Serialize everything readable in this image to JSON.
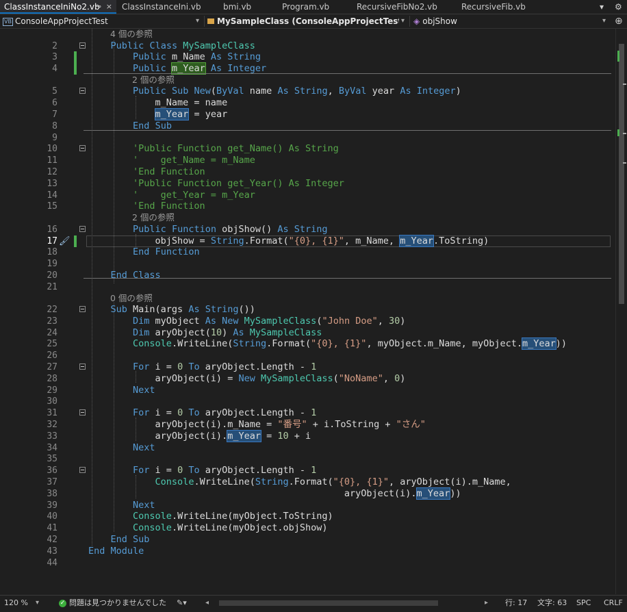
{
  "tabs": [
    {
      "label": "ClassInstanceIniNo2.vb",
      "active": true
    },
    {
      "label": "ClassInstanceIni.vb"
    },
    {
      "label": "bmi.vb"
    },
    {
      "label": "Program.vb"
    },
    {
      "label": "RecursiveFibNo2.vb"
    },
    {
      "label": "RecursiveFib.vb"
    }
  ],
  "tab_controls": {
    "overflow": "▾",
    "settings": "⚙"
  },
  "tab_close": "×",
  "tab_pin": "⊸",
  "navbar": {
    "project": "ConsoleAppProjectTest",
    "class": "MySampleClass (ConsoleAppProjectTest.Program",
    "member": "objShow",
    "vb_badge": "VB"
  },
  "code_lines": [
    {
      "n": "",
      "hint": "4 個の参照"
    },
    {
      "n": "2",
      "code": "    Public Class MySampleClass"
    },
    {
      "n": "3",
      "code": "        Public m_Name As String"
    },
    {
      "n": "4",
      "code": "        Public m_Year As Integer"
    },
    {
      "n": "",
      "hint": "2 個の参照"
    },
    {
      "n": "5",
      "code": "        Public Sub New(ByVal name As String, ByVal year As Integer)"
    },
    {
      "n": "6",
      "code": "            m_Name = name"
    },
    {
      "n": "7",
      "code": "            m_Year = year"
    },
    {
      "n": "8",
      "code": "        End Sub"
    },
    {
      "n": "9",
      "code": ""
    },
    {
      "n": "10",
      "code": "        'Public Function get_Name() As String"
    },
    {
      "n": "11",
      "code": "        '    get_Name = m_Name"
    },
    {
      "n": "12",
      "code": "        'End Function"
    },
    {
      "n": "13",
      "code": "        'Public Function get_Year() As Integer"
    },
    {
      "n": "14",
      "code": "        '    get_Year = m_Year"
    },
    {
      "n": "15",
      "code": "        'End Function"
    },
    {
      "n": "",
      "hint": "2 個の参照"
    },
    {
      "n": "16",
      "code": "        Public Function objShow() As String"
    },
    {
      "n": "17",
      "code": "            objShow = String.Format(\"{0}, {1}\", m_Name, m_Year.ToString)"
    },
    {
      "n": "18",
      "code": "        End Function"
    },
    {
      "n": "19",
      "code": ""
    },
    {
      "n": "20",
      "code": "    End Class"
    },
    {
      "n": "21",
      "code": ""
    },
    {
      "n": "",
      "hint": "0 個の参照"
    },
    {
      "n": "22",
      "code": "    Sub Main(args As String())"
    },
    {
      "n": "23",
      "code": "        Dim myObject As New MySampleClass(\"John Doe\", 30)"
    },
    {
      "n": "24",
      "code": "        Dim aryObject(10) As MySampleClass"
    },
    {
      "n": "25",
      "code": "        Console.WriteLine(String.Format(\"{0}, {1}\", myObject.m_Name, myObject.m_Year))"
    },
    {
      "n": "26",
      "code": ""
    },
    {
      "n": "27",
      "code": "        For i = 0 To aryObject.Length - 1"
    },
    {
      "n": "28",
      "code": "            aryObject(i) = New MySampleClass(\"NoName\", 0)"
    },
    {
      "n": "29",
      "code": "        Next"
    },
    {
      "n": "30",
      "code": ""
    },
    {
      "n": "31",
      "code": "        For i = 0 To aryObject.Length - 1"
    },
    {
      "n": "32",
      "code": "            aryObject(i).m_Name = \"番号\" + i.ToString + \"さん\""
    },
    {
      "n": "33",
      "code": "            aryObject(i).m_Year = 10 + i"
    },
    {
      "n": "34",
      "code": "        Next"
    },
    {
      "n": "35",
      "code": ""
    },
    {
      "n": "36",
      "code": "        For i = 0 To aryObject.Length - 1"
    },
    {
      "n": "37",
      "code": "            Console.WriteLine(String.Format(\"{0}, {1}\", aryObject(i).m_Name,"
    },
    {
      "n": "38",
      "code": "                                              aryObject(i).m_Year))"
    },
    {
      "n": "39",
      "code": "        Next"
    },
    {
      "n": "40",
      "code": "        Console.WriteLine(myObject.ToString)"
    },
    {
      "n": "41",
      "code": "        Console.WriteLine(myObject.objShow)"
    },
    {
      "n": "42",
      "code": "    End Sub"
    },
    {
      "n": "43",
      "code": "End Module"
    },
    {
      "n": "44",
      "code": ""
    }
  ],
  "current_line": "17",
  "status": {
    "zoom": "120 %",
    "issues": "問題は見つかりませんでした",
    "line": "行: 17",
    "col": "文字: 63",
    "spc": "SPC",
    "eol": "CRLF"
  },
  "colors": {
    "keyword": "#569cd6",
    "type": "#4ec9b0",
    "string": "#d69d85",
    "comment": "#57a64a",
    "number": "#b5cea8",
    "accent": "#0e70c0"
  }
}
